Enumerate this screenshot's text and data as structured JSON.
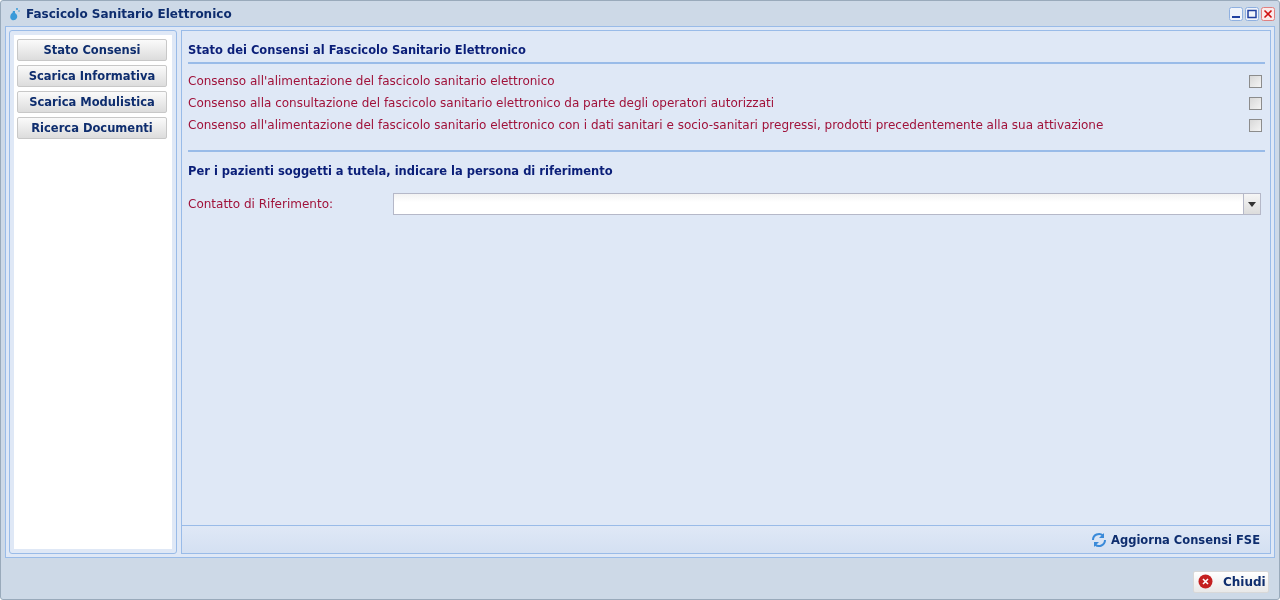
{
  "window": {
    "title": "Fascicolo Sanitario Elettronico"
  },
  "sidebar": {
    "buttons": [
      {
        "label": "Stato Consensi"
      },
      {
        "label": "Scarica Informativa"
      },
      {
        "label": "Scarica Modulistica"
      },
      {
        "label": "Ricerca Documenti"
      }
    ]
  },
  "consents": {
    "title": "Stato dei Consensi al Fascicolo Sanitario Elettronico",
    "items": [
      {
        "label": "Consenso all'alimentazione del fascicolo sanitario elettronico",
        "checked": false
      },
      {
        "label": "Consenso alla consultazione del fascicolo sanitario elettronico da parte degli operatori autorizzati",
        "checked": false
      },
      {
        "label": "Consenso all'alimentazione del fascicolo sanitario elettronico con i dati sanitari e socio-sanitari pregressi, prodotti precedentemente alla sua attivazione",
        "checked": false
      }
    ]
  },
  "reference": {
    "title": "Per i pazienti soggetti a tutela, indicare la persona di riferimento",
    "field_label": "Contatto di Riferimento:"
  },
  "toolbar": {
    "refresh_button": "Aggiorna Consensi FSE"
  },
  "footer": {
    "close_button": "Chiudi"
  }
}
